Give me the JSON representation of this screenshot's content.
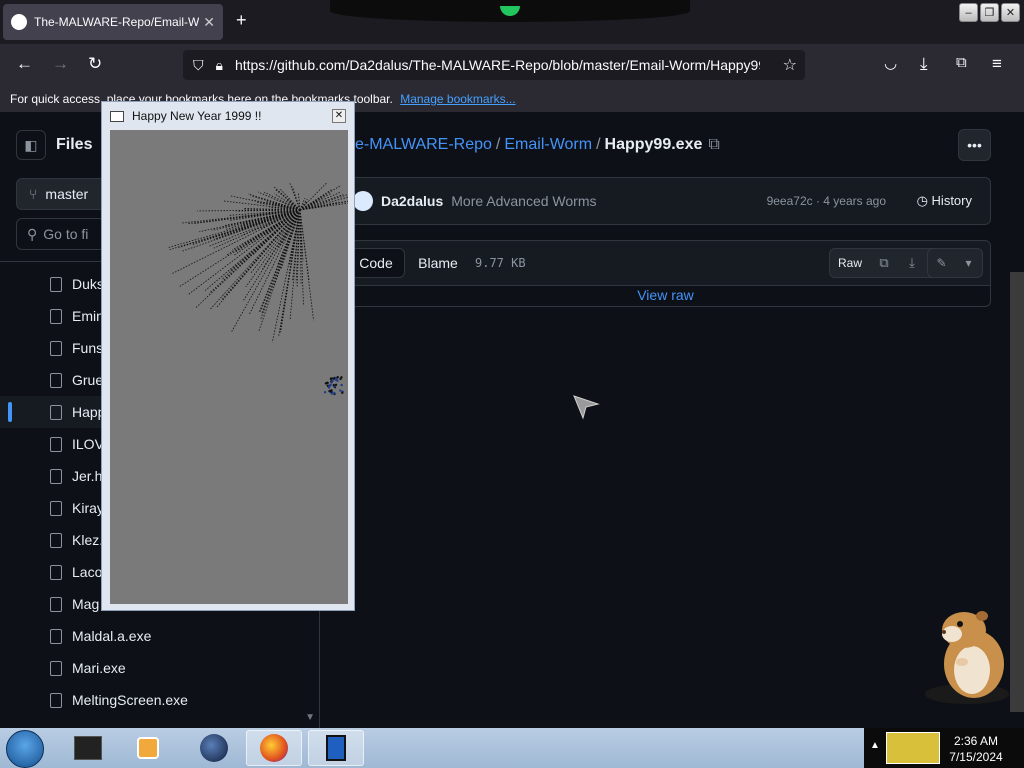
{
  "browser": {
    "tab_title": "The-MALWARE-Repo/Email-W",
    "new_tab": "+",
    "url": "https://github.com/Da2dalus/The-MALWARE-Repo/blob/master/Email-Worm/Happy99",
    "bookmarks_text": "For quick access, place your bookmarks here on the bookmarks toolbar.",
    "bookmarks_link": "Manage bookmarks..."
  },
  "sidebar": {
    "title": "Files",
    "branch": "master",
    "search_placeholder": "Go to fi",
    "files": [
      "Duks",
      "Emin",
      "Funs",
      "Grue",
      "Happ",
      "ILOV",
      "Jer.h",
      "Kiray",
      "Klez.",
      "Laco",
      "Mag",
      "Maldal.a.exe",
      "Mari.exe",
      "MeltingScreen.exe"
    ],
    "active_index": 4
  },
  "breadcrumb": {
    "repo": "e-MALWARE-Repo",
    "folder": "Email-Worm",
    "file": "Happy99.exe"
  },
  "commit": {
    "author": "Da2dalus",
    "message": "More Advanced Worms",
    "meta": "9eea72c · 4 years ago",
    "history": "History"
  },
  "codebar": {
    "code_tab": "Code",
    "blame_tab": "Blame",
    "size": "9.77 KB",
    "raw": "Raw",
    "view_raw": "View raw"
  },
  "popup": {
    "title": "Happy New Year 1999 !!"
  },
  "taskbar": {
    "time": "2:36 AM",
    "date": "7/15/2024"
  }
}
